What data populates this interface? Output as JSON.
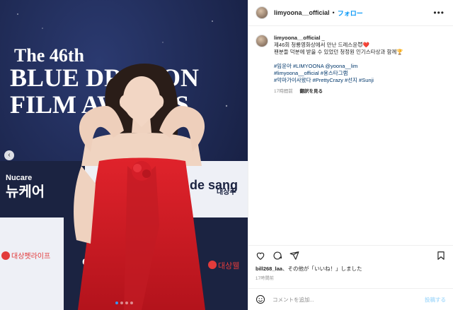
{
  "photo": {
    "backdrop_line1": "The 46th",
    "backdrop_line2": "BLUE DRAGON",
    "backdrop_line3": "FILM AWARDS",
    "sponsor_nucare_small": "Nucare",
    "sponsor_nucare_big": "뉴케어",
    "sponsor_daesang": "대상주",
    "sponsor_daesang_pet": "대상펫라이프",
    "sponsor_daesang_well": "대상웰",
    "sponsor_desang_logo": "de sang",
    "dot_count": 4,
    "active_dot": 0
  },
  "header": {
    "username": "limyoona__official",
    "separator": "•",
    "follow_label": "フォロー",
    "more_label": "•••"
  },
  "caption": {
    "username": "limyoona__official",
    "trailing": "_",
    "line1": "제46회 청룡영화상에서 만난 드레스윤😈❤️",
    "line2": "팬분들 덕분에 받을 수 있었던 청정원 인기스타상과 함께🏆",
    "tags_line1": "#임윤아 #LIMYOONA @yoona__lim",
    "tags_line2": "#limyoona__official #용스타그램",
    "tags_line3": "#악마가이사왔다 #PrettyCrazy #선지 #Sunji",
    "time": "17時間前",
    "translate_label": "翻訳を見る"
  },
  "engagement": {
    "liked_by_user": "bill268_laa",
    "liked_by_rest": "、その他が「いいね！」しました",
    "date": "17時間前"
  },
  "comment": {
    "placeholder": "コメントを追加...",
    "post_label": "投稿する"
  }
}
